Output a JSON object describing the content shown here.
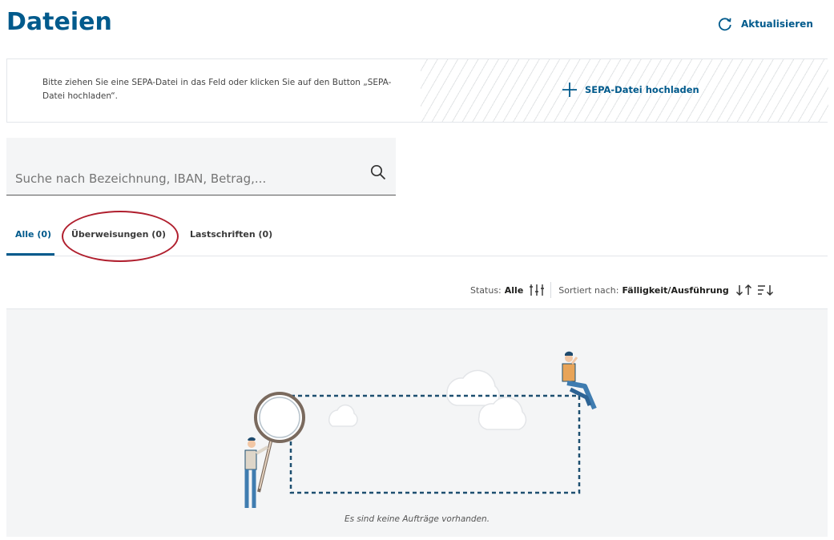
{
  "header": {
    "title": "Dateien",
    "refresh_label": "Aktualisieren"
  },
  "upload": {
    "hint": "Bitte ziehen Sie eine SEPA-Datei in das Feld oder klicken Sie auf den Button „SEPA-Datei hochladen“.",
    "button_label": "SEPA-Datei hochladen"
  },
  "search": {
    "placeholder": "Suche nach Bezeichnung, IBAN, Betrag,..."
  },
  "tabs": [
    {
      "label": "Alle (0)",
      "active": true
    },
    {
      "label": "Überweisungen (0)",
      "active": false
    },
    {
      "label": "Lastschriften (0)",
      "active": false
    }
  ],
  "filters": {
    "status_label": "Status:",
    "status_value": "Alle",
    "sort_label": "Sortiert nach:",
    "sort_value": "Fälligkeit/Ausführung"
  },
  "empty_state": {
    "message": "Es sind keine Aufträge vorhanden."
  },
  "icons": {
    "refresh": "refresh-icon",
    "upload": "plus-icon",
    "search": "search-icon",
    "status_filter": "filter-sliders-icon",
    "sort_direction": "sort-arrows-icon",
    "sort_options": "sort-list-icon"
  },
  "colors": {
    "brand": "#005a8c",
    "annotation": "#b01f2e",
    "panel_bg": "#f4f5f6"
  }
}
